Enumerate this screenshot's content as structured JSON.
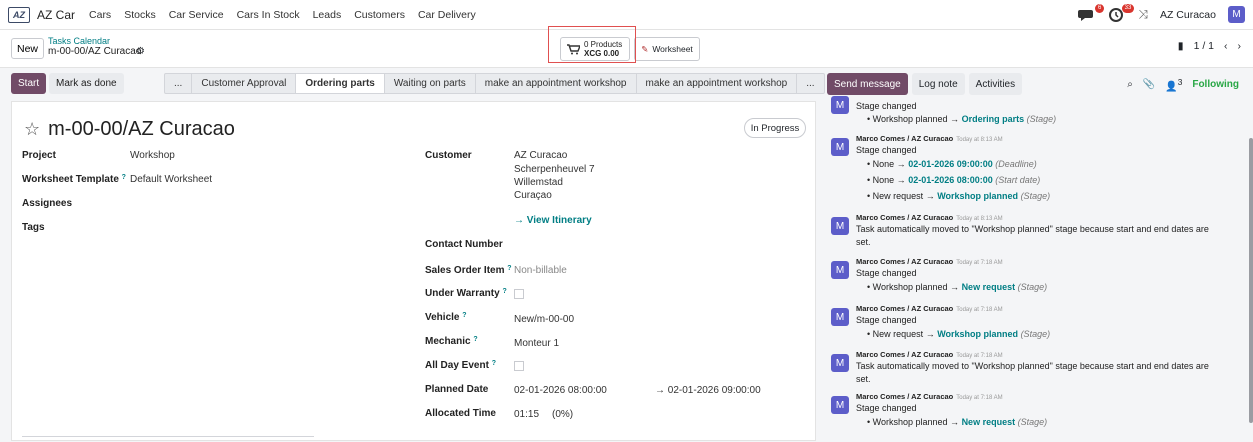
{
  "app": {
    "logo": "AZ",
    "name": "AZ Car",
    "menu": [
      "Cars",
      "Stocks",
      "Car Service",
      "Cars In Stock",
      "Leads",
      "Customers",
      "Car Delivery"
    ],
    "notif_count": "6",
    "activity_count": "33",
    "company": "AZ Curacao",
    "user_initial": "M"
  },
  "control": {
    "new_label": "New",
    "breadcrumb_parent": "Tasks Calendar",
    "breadcrumb_current": "m-00-00/AZ Curacao",
    "products_line1": "0 Products",
    "products_line2": "XCG 0.00",
    "worksheet_label": "Worksheet",
    "pager": "1 / 1"
  },
  "statusbar": {
    "start": "Start",
    "mark_done": "Mark as done",
    "ellipsis_left": "...",
    "stages": [
      "Customer Approval",
      "Ordering parts",
      "Waiting on parts",
      "make an appointment workshop",
      "make an appointment workshop"
    ],
    "ellipsis_right": "...",
    "active_stage": "Ordering parts"
  },
  "form": {
    "title": "m-00-00/AZ Curacao",
    "state": "In Progress",
    "left": {
      "project_label": "Project",
      "project": "Workshop",
      "template_label": "Worksheet Template",
      "template": "Default Worksheet",
      "assignees_label": "Assignees",
      "tags_label": "Tags"
    },
    "right": {
      "customer_label": "Customer",
      "customer_name": "AZ Curacao",
      "customer_street": "Scherpenheuvel 7",
      "customer_city": "Willemstad",
      "customer_country": "Curaçao",
      "itinerary": "View Itinerary",
      "contact_label": "Contact Number",
      "so_label": "Sales Order Item",
      "so": "Non-billable",
      "warranty_label": "Under Warranty",
      "vehicle_label": "Vehicle",
      "vehicle": "New/m-00-00",
      "mechanic_label": "Mechanic",
      "mechanic": "Monteur 1",
      "allday_label": "All Day Event",
      "planned_label": "Planned Date",
      "planned_start": "02-01-2026 08:00:00",
      "planned_end": "02-01-2026 09:00:00",
      "alloc_label": "Allocated Time",
      "alloc_time": "01:15",
      "alloc_pct": "(0%)"
    }
  },
  "chatter": {
    "send": "Send message",
    "log": "Log note",
    "activities": "Activities",
    "followers": "3",
    "following": "Following",
    "messages": [
      {
        "author": "",
        "when": "",
        "lines": [
          "Stage changed"
        ],
        "items": [
          {
            "old": "Workshop planned",
            "new": "Ordering parts",
            "field": "(Stage)"
          }
        ]
      },
      {
        "author": "Marco Comes / AZ Curacao",
        "when": "Today at 8:13 AM",
        "lines": [
          "Stage changed"
        ],
        "items": [
          {
            "old": "None",
            "new": "02-01-2026 09:00:00",
            "field": "(Deadline)"
          },
          {
            "old": "None",
            "new": "02-01-2026 08:00:00",
            "field": "(Start date)"
          },
          {
            "old": "New request",
            "new": "Workshop planned",
            "field": "(Stage)"
          }
        ]
      },
      {
        "author": "Marco Comes / AZ Curacao",
        "when": "Today at 8:13 AM",
        "lines": [
          "Task automatically moved to \"Workshop planned\" stage because start and end dates are",
          "set."
        ],
        "items": []
      },
      {
        "author": "Marco Comes / AZ Curacao",
        "when": "Today at 7:18 AM",
        "lines": [
          "Stage changed"
        ],
        "items": [
          {
            "old": "Workshop planned",
            "new": "New request",
            "field": "(Stage)"
          }
        ]
      },
      {
        "author": "Marco Comes / AZ Curacao",
        "when": "Today at 7:18 AM",
        "lines": [
          "Stage changed"
        ],
        "items": [
          {
            "old": "New request",
            "new": "Workshop planned",
            "field": "(Stage)"
          }
        ]
      },
      {
        "author": "Marco Comes / AZ Curacao",
        "when": "Today at 7:18 AM",
        "lines": [
          "Task automatically moved to \"Workshop planned\" stage because start and end dates are",
          "set."
        ],
        "items": []
      },
      {
        "author": "Marco Comes / AZ Curacao",
        "when": "Today at 7:18 AM",
        "lines": [
          "Stage changed"
        ],
        "items": [
          {
            "old": "Workshop planned",
            "new": "New request",
            "field": "(Stage)"
          }
        ]
      }
    ]
  },
  "colors": {
    "primary": "#714b67",
    "teal": "#017e84",
    "avatar": "#5c5dc9"
  }
}
